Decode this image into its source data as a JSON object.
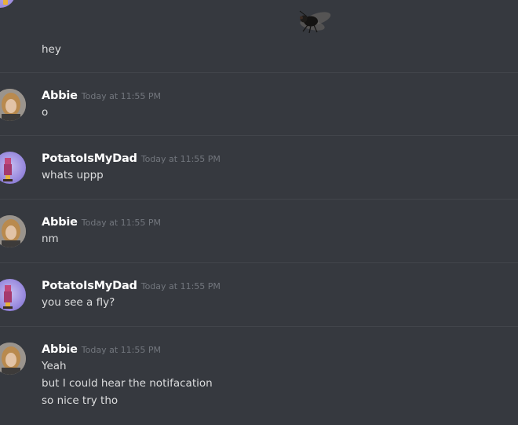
{
  "colors": {
    "background": "#36393f",
    "divider": "#42454b",
    "username": "#ffffff",
    "message_text": "#dcddde",
    "timestamp": "#72767d"
  },
  "continued_message": {
    "text": "hey"
  },
  "groups": [
    {
      "author": "Abbie",
      "avatar_icon": "abbie-avatar",
      "timestamp": "Today at 11:55 PM",
      "lines": [
        "o"
      ]
    },
    {
      "author": "PotatoIsMyDad",
      "avatar_icon": "potato-avatar",
      "timestamp": "Today at 11:55 PM",
      "lines": [
        "whats uppp"
      ]
    },
    {
      "author": "Abbie",
      "avatar_icon": "abbie-avatar",
      "timestamp": "Today at 11:55 PM",
      "lines": [
        "nm"
      ]
    },
    {
      "author": "PotatoIsMyDad",
      "avatar_icon": "potato-avatar",
      "timestamp": "Today at 11:55 PM",
      "lines": [
        "you see a fly?"
      ]
    },
    {
      "author": "Abbie",
      "avatar_icon": "abbie-avatar",
      "timestamp": "Today at 11:55 PM",
      "lines": [
        "Yeah",
        "but I could hear the notifacation",
        "so nice try tho"
      ]
    }
  ]
}
